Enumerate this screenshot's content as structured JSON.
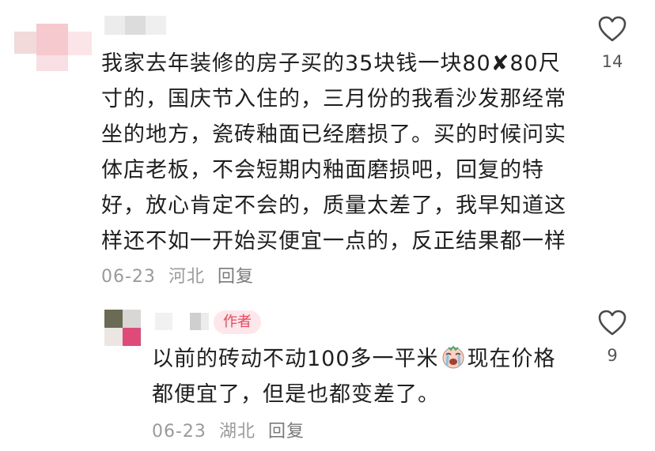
{
  "comment": {
    "text": "我家去年装修的房子买的35块钱一块80✘80尺寸的，国庆节入住的，三月份的我看沙发那经常坐的地方，瓷砖釉面已经磨损了。买的时候问实体店老板，不会短期内釉面磨损吧，回复的特好，放心肯定不会的，质量太差了，我早知道这样还不如一开始买便宜一点的，反正结果都一样",
    "lines": [
      "我家去年装修的房子买的35块钱一块80✘80尺",
      "寸的，国庆节入住的，三月份的我看沙发那经常",
      "坐的地方，瓷砖釉面已经磨损了。买的时候问实",
      "体店老板，不会短期内釉面磨损吧，回复的特",
      "好，放心肯定不会的，质量太差了，我早知道这",
      "样还不如一开始买便宜一点的，反正结果都一样"
    ],
    "date": "06-23",
    "location": "河北",
    "reply_label": "回复",
    "like_count": "14",
    "like_icon": "heart-outline-icon"
  },
  "reply": {
    "author_badge": "作者",
    "line1_before": "以前的砖动不动100多一平米",
    "emoji": "crying-face-emoji",
    "line1_after": "现在价格",
    "line2": "都便宜了，但是也都变差了。",
    "date": "06-23",
    "location": "湖北",
    "reply_label": "回复",
    "like_count": "9",
    "like_icon": "heart-outline-icon"
  }
}
